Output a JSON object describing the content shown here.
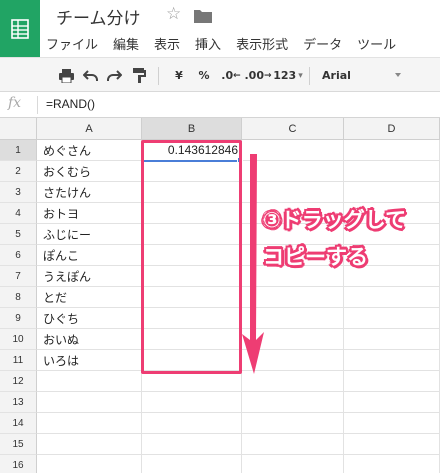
{
  "app": {
    "logo_icon": "sheets-grid-icon",
    "brand_color": "#21a464",
    "title": "チーム分け",
    "star_icon": "star-icon",
    "star_glyph": "☆",
    "folder_icon": "folder-icon"
  },
  "menu": [
    "ファイル",
    "編集",
    "表示",
    "挿入",
    "表示形式",
    "データ",
    "ツール"
  ],
  "toolbar": {
    "icons": [
      "print-icon",
      "undo-icon",
      "redo-icon",
      "paint-format-icon"
    ],
    "currency_label": "¥",
    "percent_label": "%",
    "decrease_decimal_label": ".0",
    "decrease_decimal_sub": "←",
    "increase_decimal_label": ".00",
    "increase_decimal_sub": "→",
    "more_formats_label": "123",
    "more_formats_caret": "▾",
    "font_name": "Arial"
  },
  "formula_bar": {
    "fx_label": "fx",
    "formula": "=RAND()"
  },
  "sheet": {
    "columns": [
      "A",
      "B",
      "C",
      "D"
    ],
    "rows": [
      "1",
      "2",
      "3",
      "4",
      "5",
      "6",
      "7",
      "8",
      "9",
      "10",
      "11",
      "12",
      "13",
      "14",
      "15",
      "16"
    ],
    "names": [
      "めぐさん",
      "おくむら",
      "さたけん",
      "おトヨ",
      "ふじにー",
      "ぽんこ",
      "うえぽん",
      "とだ",
      "ひぐち",
      "おいぬ",
      "いろは"
    ],
    "b1_value": "0.143612846",
    "selected_cell": "B1"
  },
  "annotation": {
    "line1": "③ドラッグして",
    "line2": "コピーする",
    "color": "#ee3d73"
  }
}
